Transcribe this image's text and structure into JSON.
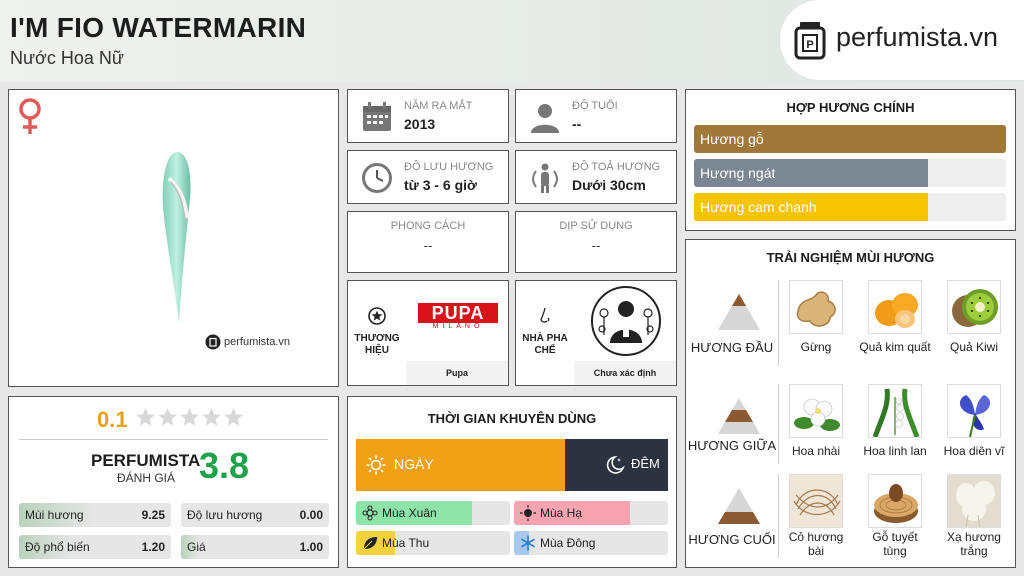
{
  "header": {
    "title": "I'M FIO WATERMARIN",
    "subtitle": "Nước Hoa Nữ",
    "brand": "perfumista.vn"
  },
  "image_card": {
    "watermark": "perfumista.vn"
  },
  "info": {
    "release": {
      "label": "NĂM RA MẮT",
      "value": "2013",
      "icon": "calendar-icon"
    },
    "age": {
      "label": "ĐỘ TUỔI",
      "value": "--",
      "icon": "person-icon"
    },
    "longevity": {
      "label": "ĐỘ LƯU HƯƠNG",
      "value": "từ 3 - 6 giờ",
      "icon": "clock-icon"
    },
    "sillage": {
      "label": "ĐỘ TOẢ HƯƠNG",
      "value": "Dưới 30cm",
      "icon": "sillage-icon"
    },
    "style": {
      "label": "PHONG CÁCH",
      "value": "--"
    },
    "occasion": {
      "label": "DỊP SỬ DỤNG",
      "value": "--"
    }
  },
  "brand_card": {
    "label": "THƯƠNG HIỆU",
    "name": "Pupa",
    "logo_main": "PUPA",
    "logo_sub": "MILANO"
  },
  "perfumer_card": {
    "label": "NHÀ PHA CHẾ",
    "name": "Chưa xác định"
  },
  "rating": {
    "user_score": "0.1",
    "user_stars_filled": 0,
    "pf_label": "PERFUMISTA",
    "pf_sub": "ĐÁNH GIÁ",
    "pf_score": "3.8",
    "metrics": [
      {
        "label": "Mùi hương",
        "value": "9.25",
        "fraction": 0.5
      },
      {
        "label": "Độ lưu hương",
        "value": "0.00",
        "fraction": 0
      },
      {
        "label": "Độ phổ biến",
        "value": "1.20",
        "fraction": 0.35
      },
      {
        "label": "Giá",
        "value": "1.00",
        "fraction": 0.12
      }
    ]
  },
  "time": {
    "title": "THỜI GIAN KHUYÊN DÙNG",
    "day": {
      "label": "NGÀY",
      "fraction": 0.67
    },
    "night": {
      "label": "ĐÊM",
      "fraction": 0.33
    },
    "seasons": [
      {
        "label": "Mùa Xuân",
        "fraction": 0.75,
        "color": "#8ee4a8",
        "icon": "spring-icon"
      },
      {
        "label": "Mùa Hạ",
        "fraction": 0.75,
        "color": "#f7a3b0",
        "icon": "sun-icon"
      },
      {
        "label": "Mùa Thu",
        "fraction": 0.25,
        "color": "#f6d23a",
        "icon": "leaf-icon"
      },
      {
        "label": "Mùa Đông",
        "fraction": 0.1,
        "color": "#a6c8f0",
        "icon": "snowflake-icon"
      }
    ]
  },
  "accords": {
    "title": "HỢP HƯƠNG CHÍNH",
    "items": [
      {
        "label": "Hương gỗ",
        "fraction": 1.0,
        "color": "#a0783a"
      },
      {
        "label": "Hương ngát",
        "fraction": 0.75,
        "color": "#7b8693"
      },
      {
        "label": "Hương cam chanh",
        "fraction": 0.75,
        "color": "#f6c400"
      }
    ]
  },
  "notes": {
    "title": "TRẢI NGHIỆM MÙI HƯƠNG",
    "tiers": [
      {
        "name": "HƯƠNG ĐẦU",
        "items": [
          "Gừng",
          "Quả kim quất",
          "Quả Kiwi"
        ]
      },
      {
        "name": "HƯƠNG GIỮA",
        "items": [
          "Hoa nhài",
          "Hoa linh lan",
          "Hoa diên vĩ"
        ]
      },
      {
        "name": "HƯƠNG CUỐI",
        "items": [
          "Cỏ hương bài",
          "Gỗ tuyết tùng",
          "Xạ hương trắng"
        ]
      }
    ]
  }
}
